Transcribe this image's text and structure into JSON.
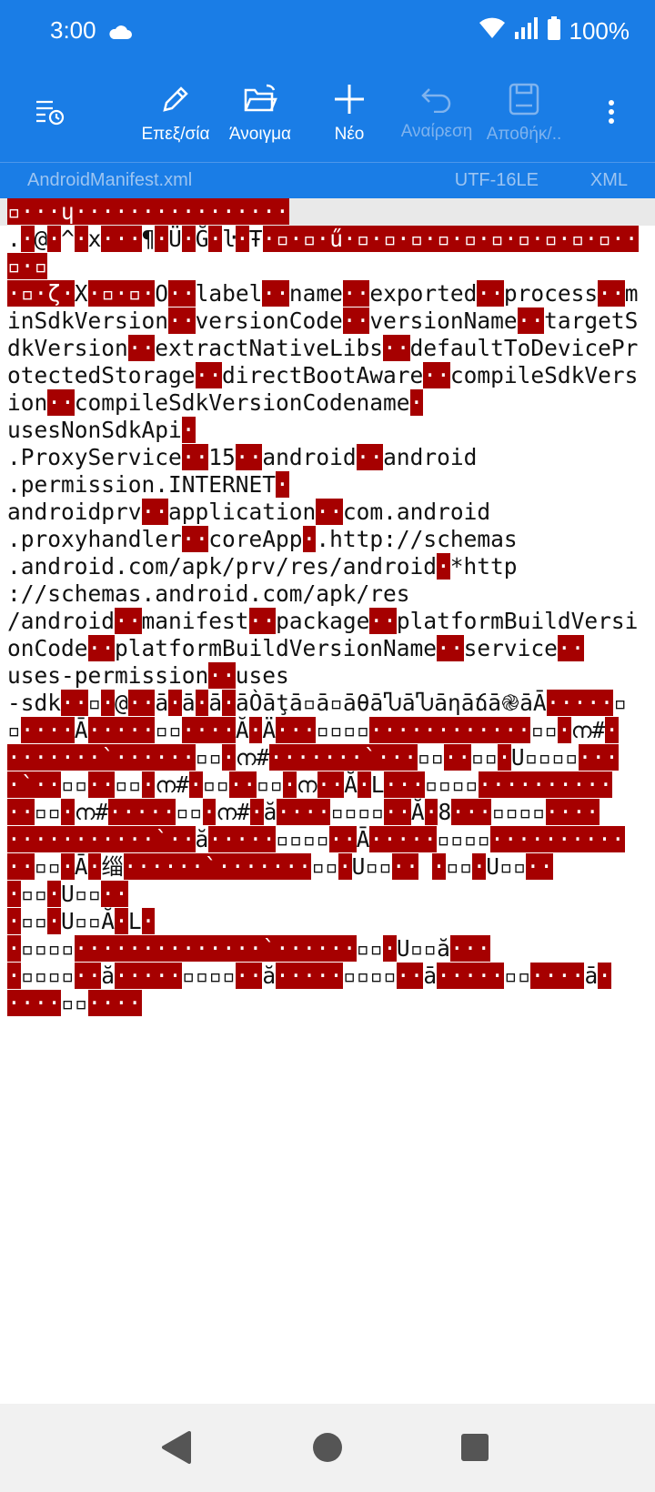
{
  "status_bar": {
    "time": "3:00",
    "battery": "100%"
  },
  "toolbar": {
    "recent_icon": "recent-files-icon",
    "edit_label": "Επεξ/σία",
    "open_label": "Άνοιγμα",
    "new_label": "Νέο",
    "undo_label": "Αναίρεση",
    "save_label": "Αποθήκ/..",
    "more_icon": "more-vert-icon"
  },
  "file_bar": {
    "filename": "AndroidManifest.xml",
    "encoding": "UTF-16LE",
    "language": "XML"
  },
  "editor": {
    "segments": [
      {
        "t": "▫···ɥ················",
        "r": true
      },
      {
        "t": "\n."
      },
      {
        "t": "·",
        "r": true
      },
      {
        "t": "@"
      },
      {
        "t": "·",
        "r": true
      },
      {
        "t": "^"
      },
      {
        "t": "·",
        "r": true
      },
      {
        "t": "x"
      },
      {
        "t": "···",
        "r": true
      },
      {
        "t": "¶"
      },
      {
        "t": "·",
        "r": true
      },
      {
        "t": "Ü"
      },
      {
        "t": "·",
        "r": true
      },
      {
        "t": "Ğ"
      },
      {
        "t": "·",
        "r": true
      },
      {
        "t": "ŀ"
      },
      {
        "t": "·",
        "r": true
      },
      {
        "t": "Ŧ"
      },
      {
        "t": "·▫·▫·ű·▫·▫·▫·▫·▫·▫·▫·▫·▫·▫··▫·▫",
        "r": true
      },
      {
        "t": "\n"
      },
      {
        "t": "·▫·ζ·",
        "r": true
      },
      {
        "t": "Χ"
      },
      {
        "t": "·▫·▫·",
        "r": true
      },
      {
        "t": "Ο"
      },
      {
        "t": "··",
        "r": true
      },
      {
        "t": "label"
      },
      {
        "t": "··",
        "r": true
      },
      {
        "t": "name"
      },
      {
        "t": "··",
        "r": true
      },
      {
        "t": "exported"
      },
      {
        "t": "··",
        "r": true
      },
      {
        "t": "process"
      },
      {
        "t": "··",
        "r": true
      },
      {
        "t": "minSdkVersion"
      },
      {
        "t": "··",
        "r": true
      },
      {
        "t": "versionCode"
      },
      {
        "t": "··",
        "r": true
      },
      {
        "t": "versionName"
      },
      {
        "t": "··",
        "r": true
      },
      {
        "t": "targetSdkVersion"
      },
      {
        "t": "··",
        "r": true
      },
      {
        "t": "extractNativeLibs"
      },
      {
        "t": "··",
        "r": true
      },
      {
        "t": "defaultToDeviceProtectedStorage"
      },
      {
        "t": "··",
        "r": true
      },
      {
        "t": "directBootAware"
      },
      {
        "t": "··",
        "r": true
      },
      {
        "t": "compileSdkVersion"
      },
      {
        "t": "··",
        "r": true
      },
      {
        "t": "compileSdkVersionCodename"
      },
      {
        "t": "·",
        "r": true
      },
      {
        "t": "\nusesNonSdkApi"
      },
      {
        "t": "·",
        "r": true
      },
      {
        "t": "\n.ProxyService"
      },
      {
        "t": "··",
        "r": true
      },
      {
        "t": "15"
      },
      {
        "t": "··",
        "r": true
      },
      {
        "t": "android"
      },
      {
        "t": "··",
        "r": true
      },
      {
        "t": "android\n.permission.INTERNET"
      },
      {
        "t": "·",
        "r": true
      },
      {
        "t": "\nandroidprv"
      },
      {
        "t": "··",
        "r": true
      },
      {
        "t": "application"
      },
      {
        "t": "··",
        "r": true
      },
      {
        "t": "com.android\n.proxyhandler"
      },
      {
        "t": "··",
        "r": true
      },
      {
        "t": "coreApp"
      },
      {
        "t": "·",
        "r": true
      },
      {
        "t": ".http://schemas\n.android.com/apk/prv/res/android"
      },
      {
        "t": "·",
        "r": true
      },
      {
        "t": "*http\n://schemas.android.com/apk/res\n/android"
      },
      {
        "t": "··",
        "r": true
      },
      {
        "t": "manifest"
      },
      {
        "t": "··",
        "r": true
      },
      {
        "t": "package"
      },
      {
        "t": "··",
        "r": true
      },
      {
        "t": "platformBuildVersionCode"
      },
      {
        "t": "··",
        "r": true
      },
      {
        "t": "platformBuildVersionName"
      },
      {
        "t": "··",
        "r": true
      },
      {
        "t": "service"
      },
      {
        "t": "··",
        "r": true
      },
      {
        "t": "\nuses-permission"
      },
      {
        "t": "··",
        "r": true
      },
      {
        "t": "uses\n-sdk"
      },
      {
        "t": "··",
        "r": true
      },
      {
        "t": "▫"
      },
      {
        "t": "·",
        "r": true
      },
      {
        "t": "@"
      },
      {
        "t": "··",
        "r": true
      },
      {
        "t": "ā"
      },
      {
        "t": "·",
        "r": true
      },
      {
        "t": "ā"
      },
      {
        "t": "·",
        "r": true
      },
      {
        "t": "ā"
      },
      {
        "t": "·",
        "r": true
      },
      {
        "t": "āÒāţā▫ā▫āθāჀāჀāηāճā֎āĀ"
      },
      {
        "t": "·····",
        "r": true
      },
      {
        "t": "▫\n▫"
      },
      {
        "t": "····",
        "r": true
      },
      {
        "t": "Ā"
      },
      {
        "t": "·····",
        "r": true
      },
      {
        "t": "▫▫"
      },
      {
        "t": "····",
        "r": true
      },
      {
        "t": "Ă"
      },
      {
        "t": "·",
        "r": true
      },
      {
        "t": "Ä"
      },
      {
        "t": "···",
        "r": true
      },
      {
        "t": "▫▫▫▫"
      },
      {
        "t": "············",
        "r": true
      },
      {
        "t": "▫▫"
      },
      {
        "t": "·",
        "r": true
      },
      {
        "t": "ന#"
      },
      {
        "t": "·\n·······`······",
        "r": true
      },
      {
        "t": "▫▫"
      },
      {
        "t": "·",
        "r": true
      },
      {
        "t": "ന#"
      },
      {
        "t": "·······`···",
        "r": true
      },
      {
        "t": "▫▫"
      },
      {
        "t": "··",
        "r": true
      },
      {
        "t": "▫▫"
      },
      {
        "t": "·",
        "r": true
      },
      {
        "t": "U▫▫▫▫"
      },
      {
        "t": "···\n·`··",
        "r": true
      },
      {
        "t": "▫▫"
      },
      {
        "t": "··",
        "r": true
      },
      {
        "t": "▫▫"
      },
      {
        "t": "·",
        "r": true
      },
      {
        "t": "ന#"
      },
      {
        "t": "·",
        "r": true
      },
      {
        "t": "▫▫"
      },
      {
        "t": "··",
        "r": true
      },
      {
        "t": "▫▫"
      },
      {
        "t": "·",
        "r": true
      },
      {
        "t": "ന"
      },
      {
        "t": "··",
        "r": true
      },
      {
        "t": "Ă"
      },
      {
        "t": "·",
        "r": true
      },
      {
        "t": "L"
      },
      {
        "t": "···",
        "r": true
      },
      {
        "t": "▫▫▫▫"
      },
      {
        "t": "··········\n··",
        "r": true
      },
      {
        "t": "▫▫"
      },
      {
        "t": "·",
        "r": true
      },
      {
        "t": "ന#"
      },
      {
        "t": "·····",
        "r": true
      },
      {
        "t": "▫▫"
      },
      {
        "t": "·",
        "r": true
      },
      {
        "t": "ന#"
      },
      {
        "t": "·",
        "r": true
      },
      {
        "t": "ă"
      },
      {
        "t": "····",
        "r": true
      },
      {
        "t": "▫▫▫▫"
      },
      {
        "t": "··",
        "r": true
      },
      {
        "t": "Ă"
      },
      {
        "t": "·",
        "r": true
      },
      {
        "t": "8"
      },
      {
        "t": "···",
        "r": true
      },
      {
        "t": "▫▫▫▫"
      },
      {
        "t": "····\n···········`··",
        "r": true
      },
      {
        "t": "ă"
      },
      {
        "t": "·····",
        "r": true
      },
      {
        "t": "▫▫▫▫"
      },
      {
        "t": "··",
        "r": true
      },
      {
        "t": "Ā"
      },
      {
        "t": "·····",
        "r": true
      },
      {
        "t": "▫▫▫▫"
      },
      {
        "t": "··········",
        "r": true
      },
      {
        "t": "\n"
      },
      {
        "t": "··",
        "r": true
      },
      {
        "t": "▫▫"
      },
      {
        "t": "·",
        "r": true
      },
      {
        "t": "Ā"
      },
      {
        "t": "·",
        "r": true
      },
      {
        "t": "缁"
      },
      {
        "t": "······`·······",
        "r": true
      },
      {
        "t": "▫▫"
      },
      {
        "t": "·",
        "r": true
      },
      {
        "t": "U▫▫"
      },
      {
        "t": "··",
        "r": true
      },
      {
        "t": " "
      },
      {
        "t": "·",
        "r": true
      },
      {
        "t": "▫▫"
      },
      {
        "t": "·",
        "r": true
      },
      {
        "t": "U▫▫"
      },
      {
        "t": "··",
        "r": true
      },
      {
        "t": "\n"
      },
      {
        "t": "·",
        "r": true
      },
      {
        "t": "▫▫"
      },
      {
        "t": "·",
        "r": true
      },
      {
        "t": "U▫▫"
      },
      {
        "t": "··",
        "r": true
      },
      {
        "t": "\n"
      },
      {
        "t": "·",
        "r": true
      },
      {
        "t": "▫▫"
      },
      {
        "t": "·",
        "r": true
      },
      {
        "t": "U▫▫Ă"
      },
      {
        "t": "·",
        "r": true
      },
      {
        "t": "L"
      },
      {
        "t": "·",
        "r": true
      },
      {
        "t": "\n"
      },
      {
        "t": "·",
        "r": true
      },
      {
        "t": "▫▫▫▫"
      },
      {
        "t": "··············`······",
        "r": true
      },
      {
        "t": "▫▫"
      },
      {
        "t": "·",
        "r": true
      },
      {
        "t": "U▫▫ă"
      },
      {
        "t": "···",
        "r": true
      },
      {
        "t": "\n"
      },
      {
        "t": "·",
        "r": true
      },
      {
        "t": "▫▫▫▫"
      },
      {
        "t": "··",
        "r": true
      },
      {
        "t": "ă"
      },
      {
        "t": "·····",
        "r": true
      },
      {
        "t": "▫▫▫▫"
      },
      {
        "t": "··",
        "r": true
      },
      {
        "t": "ă"
      },
      {
        "t": "·····",
        "r": true
      },
      {
        "t": "▫▫▫▫"
      },
      {
        "t": "··",
        "r": true
      },
      {
        "t": "ā"
      },
      {
        "t": "·····",
        "r": true
      },
      {
        "t": "▫▫"
      },
      {
        "t": "····",
        "r": true
      },
      {
        "t": "ā"
      },
      {
        "t": "·",
        "r": true
      },
      {
        "t": "\n"
      },
      {
        "t": "····",
        "r": true
      },
      {
        "t": "▫▫"
      },
      {
        "t": "····",
        "r": true
      }
    ]
  },
  "nav_bar": {
    "back_icon": "back-icon",
    "home_icon": "home-icon",
    "recents_icon": "recents-icon"
  },
  "colors": {
    "toolbar_bg": "#1a7de6",
    "binary_highlight": "#a60000",
    "nav_bg": "#f1f1f1"
  }
}
